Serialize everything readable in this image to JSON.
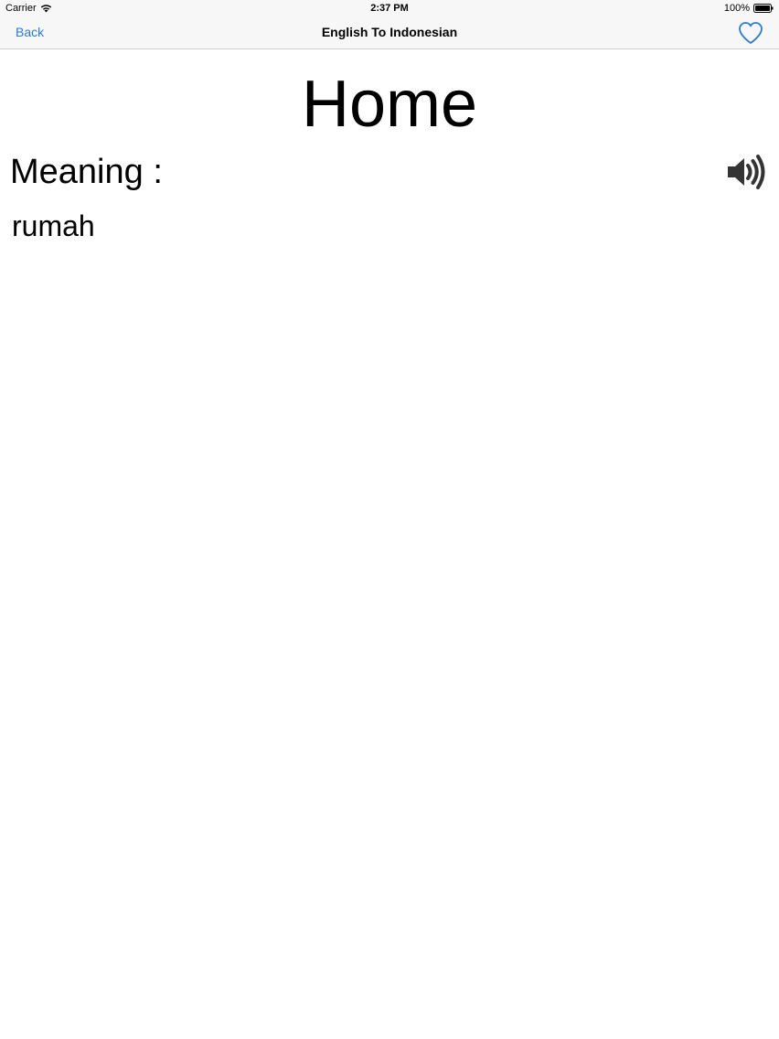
{
  "status_bar": {
    "carrier": "Carrier",
    "time": "2:37 PM",
    "battery": "100%"
  },
  "nav": {
    "back_label": "Back",
    "title": "English To Indonesian",
    "favorite_icon": "heart-icon"
  },
  "entry": {
    "word": "Home",
    "meaning_label": "Meaning :",
    "meaning": "rumah",
    "speaker_icon": "speaker-icon"
  },
  "colors": {
    "accent": "#2a7ad6",
    "bar_background": "#f7f7f7"
  }
}
